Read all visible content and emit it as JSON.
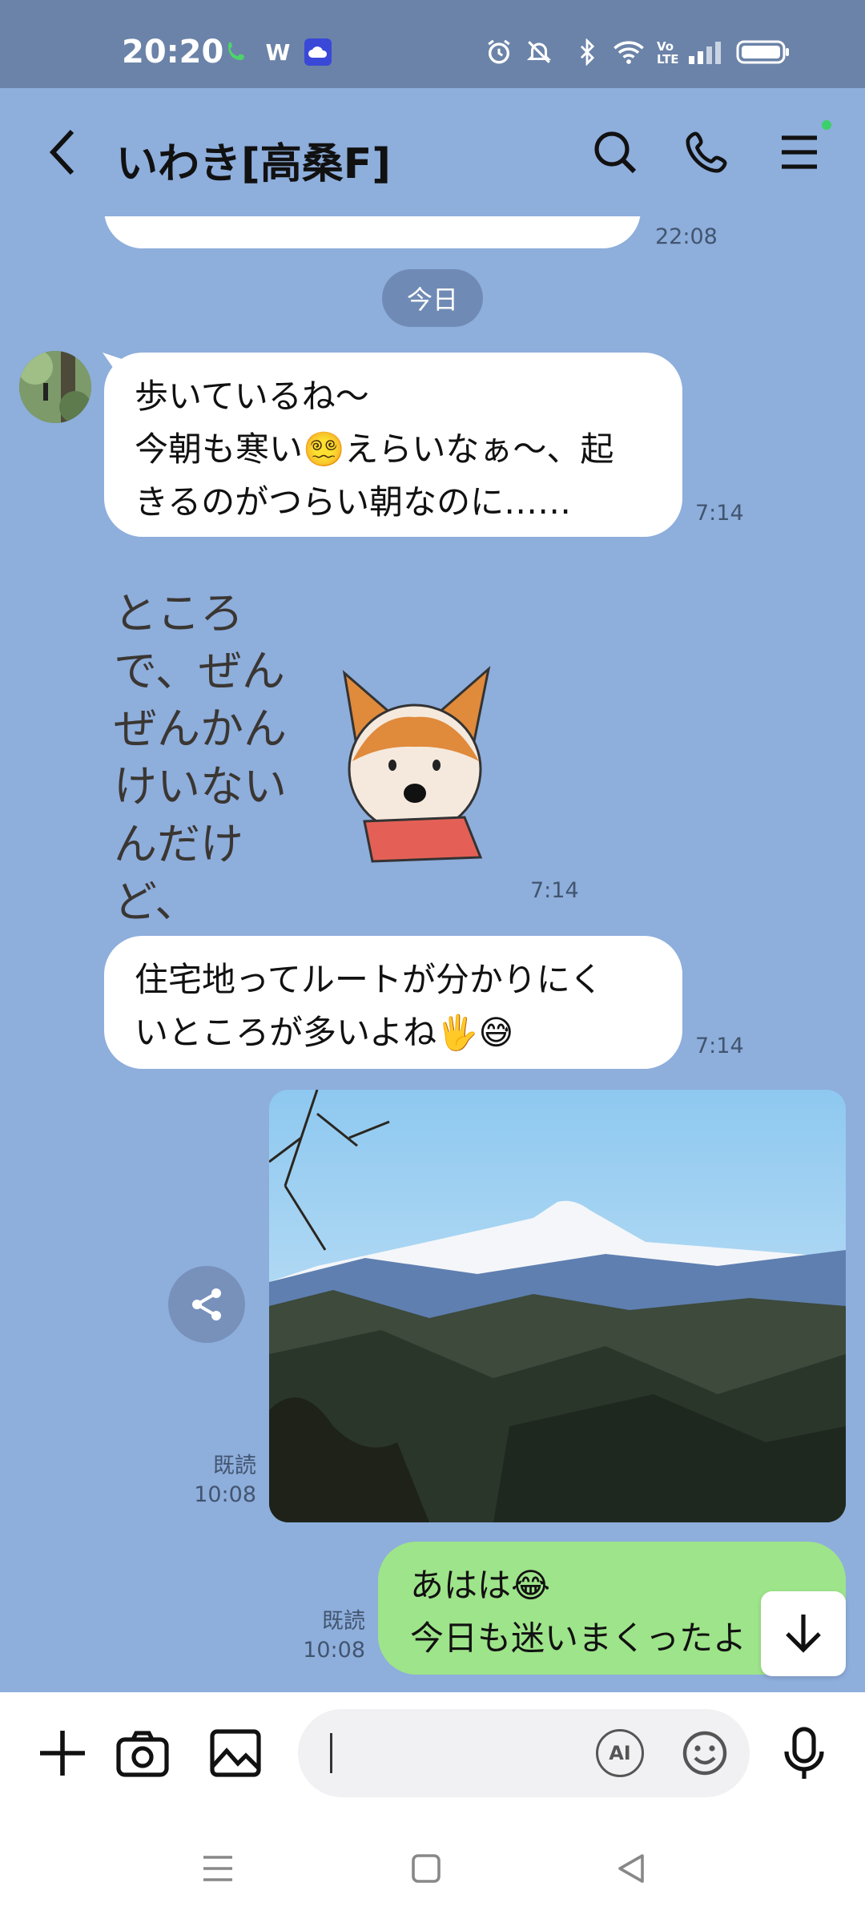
{
  "status_bar": {
    "time": "20:20",
    "volte": "Vo LTE"
  },
  "header": {
    "title": "いわき[高桑F]"
  },
  "chat": {
    "partial_prev_time": "22:08",
    "date_separator": "今日",
    "messages": [
      {
        "type": "text_in",
        "lines": [
          "歩いているね〜",
          "今朝も寒い",
          "えらいなぁ〜、起",
          "きるのがつらい朝なのに……"
        ],
        "emoji_1": "😵‍💫",
        "time": "7:14"
      },
      {
        "type": "sticker_in",
        "sticker_text": "ところで、ぜんぜんかんけいないんだけど、",
        "time": "7:14"
      },
      {
        "type": "text_in",
        "lines": [
          "住宅地ってルートが分かりにく",
          "いところが多いよね"
        ],
        "emoji": "🖐😅",
        "time": "7:14"
      },
      {
        "type": "image_out",
        "read": "既読",
        "time": "10:08"
      },
      {
        "type": "text_out",
        "lines": [
          "あはは",
          "今日も迷いまくったよ"
        ],
        "emoji": "😂",
        "read": "既読",
        "time": "10:08"
      }
    ]
  },
  "input_bar": {
    "placeholder": "",
    "ai_label": "AI"
  }
}
